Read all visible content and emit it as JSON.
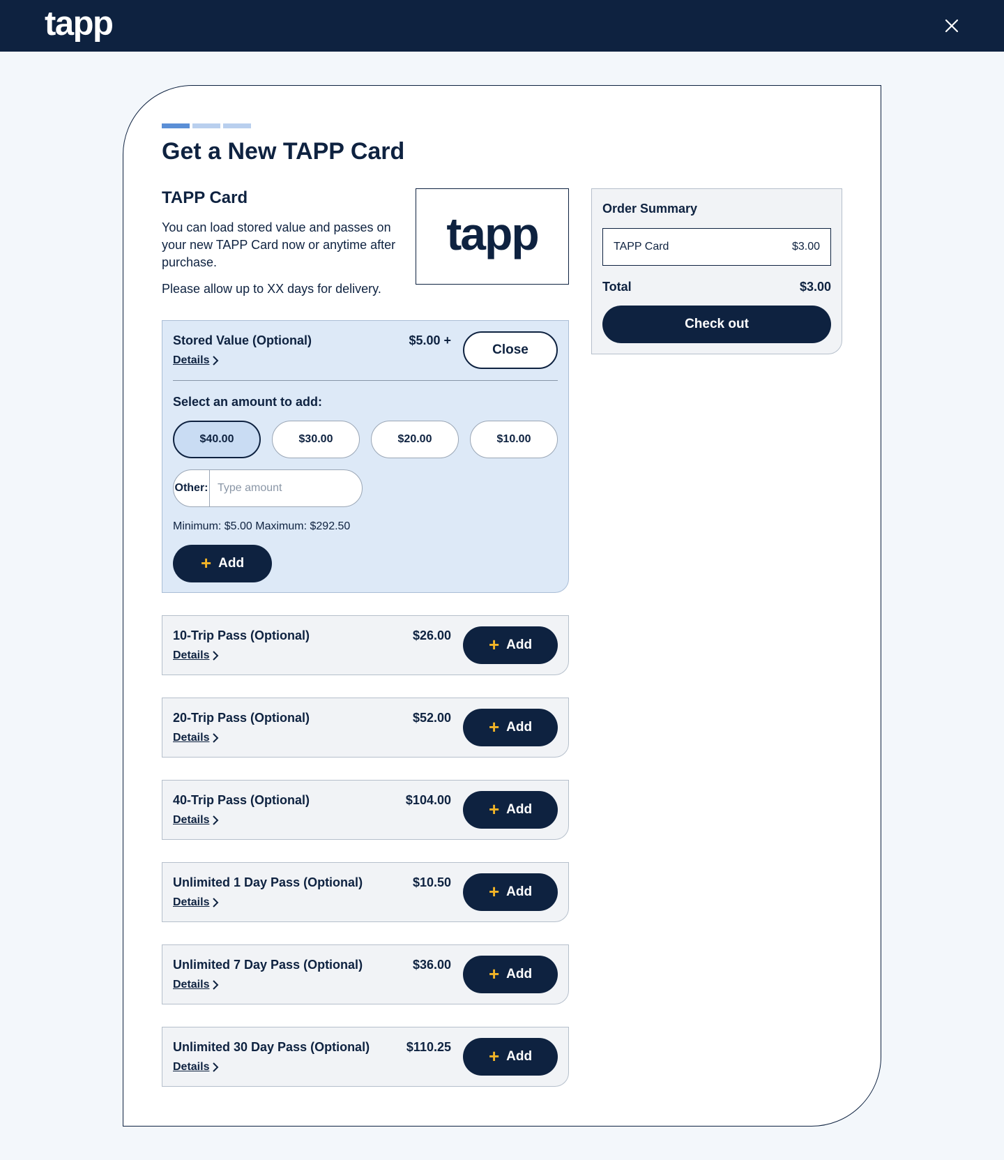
{
  "header": {
    "logo": "tapp",
    "colors": {
      "background": "#0e2240",
      "accent": "#f2b427",
      "progress_active": "#5b8fd6",
      "progress_inactive": "#b9cfee"
    }
  },
  "page": {
    "title": "Get a New TAPP Card",
    "progress": {
      "current_step": 1,
      "total_steps": 3
    }
  },
  "card_info": {
    "heading": "TAPP Card",
    "description": "You can load stored value and passes on your new TAPP Card now or anytime after purchase.",
    "delivery_note": "Please allow up to XX days for delivery.",
    "image_logo": "tapp"
  },
  "stored_value": {
    "title": "Stored Value (Optional)",
    "details_label": "Details",
    "price": "$5.00 +",
    "close_label": "Close",
    "select_label": "Select an amount to add:",
    "amounts": [
      {
        "label": "$40.00",
        "selected": true
      },
      {
        "label": "$30.00",
        "selected": false
      },
      {
        "label": "$20.00",
        "selected": false
      },
      {
        "label": "$10.00",
        "selected": false
      }
    ],
    "other_label": "Other:",
    "other_placeholder": "Type amount",
    "other_value": "",
    "limits": "Minimum: $5.00  Maximum: $292.50",
    "add_label": "Add"
  },
  "passes": [
    {
      "title": "10-Trip Pass (Optional)",
      "details_label": "Details",
      "price": "$26.00",
      "add_label": "Add"
    },
    {
      "title": "20-Trip Pass (Optional)",
      "details_label": "Details",
      "price": "$52.00",
      "add_label": "Add"
    },
    {
      "title": "40-Trip Pass (Optional)",
      "details_label": "Details",
      "price": "$104.00",
      "add_label": "Add"
    },
    {
      "title": "Unlimited 1 Day Pass (Optional)",
      "details_label": "Details",
      "price": "$10.50",
      "add_label": "Add"
    },
    {
      "title": "Unlimited 7 Day Pass (Optional)",
      "details_label": "Details",
      "price": "$36.00",
      "add_label": "Add"
    },
    {
      "title": "Unlimited 30 Day Pass (Optional)",
      "details_label": "Details",
      "price": "$110.25",
      "add_label": "Add"
    }
  ],
  "order_summary": {
    "title": "Order Summary",
    "items": [
      {
        "name": "TAPP Card",
        "price": "$3.00"
      }
    ],
    "total_label": "Total",
    "total_value": "$3.00",
    "checkout_label": "Check out"
  }
}
